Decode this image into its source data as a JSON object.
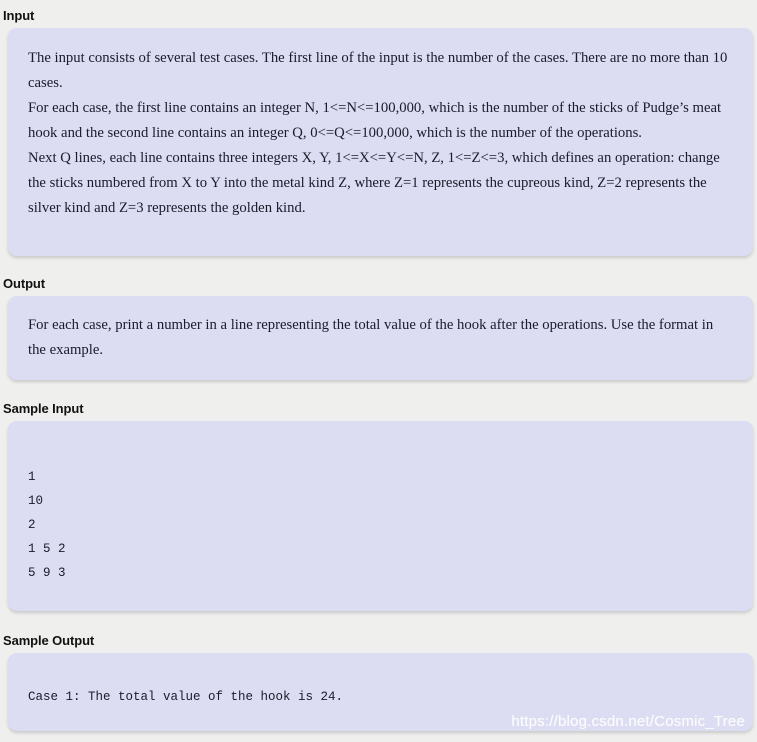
{
  "colors": {
    "page_background": "#efefee",
    "panel_background": "#dcdcf2",
    "heading_text": "#111111",
    "body_text": "#1b1b2b",
    "watermark_text": "#ffffff"
  },
  "sections": {
    "input": {
      "heading": "Input",
      "paragraphs": [
        "The input consists of several test cases. The first line of the input is the number of the cases. There are no more than 10 cases.",
        "For each case, the first line contains an integer N, 1<=N<=100,000, which is the number of the sticks of Pudge’s meat hook and the second line contains an integer Q, 0<=Q<=100,000, which is the number of the operations.",
        "Next Q lines, each line contains three integers X, Y, 1<=X<=Y<=N, Z, 1<=Z<=3, which defines an operation: change the sticks numbered from X to Y into the metal kind Z, where Z=1 represents the cupreous kind, Z=2 represents the silver kind and Z=3 represents the golden kind."
      ]
    },
    "output": {
      "heading": "Output",
      "paragraphs": [
        "For each case, print a number in a line representing the total value of the hook after the operations. Use the format in the example."
      ]
    },
    "sample_input": {
      "heading": "Sample Input",
      "code": "1\n10\n2\n1 5 2\n5 9 3"
    },
    "sample_output": {
      "heading": "Sample Output",
      "code": "Case 1: The total value of the hook is 24."
    }
  },
  "watermark": {
    "text": "https://blog.csdn.net/Cosmic_Tree"
  }
}
